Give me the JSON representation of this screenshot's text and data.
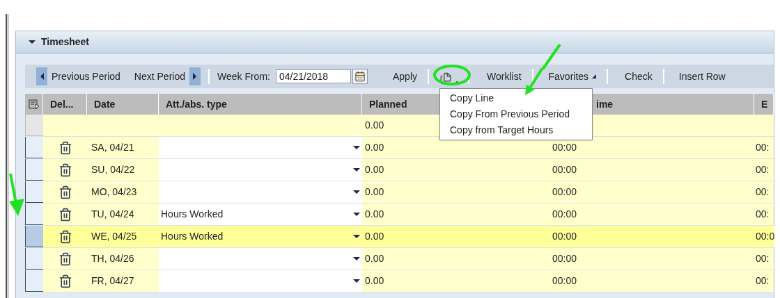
{
  "panel": {
    "title": "Timesheet",
    "expanded": true
  },
  "toolbar": {
    "previous": "Previous Period",
    "next": "Next Period",
    "week_label": "Week From:",
    "week_value": "04/21/2018",
    "apply": "Apply",
    "worklist": "Worklist",
    "favorites": "Favorites",
    "check": "Check",
    "insert_row": "Insert Row"
  },
  "copy_menu": {
    "open": true,
    "items": [
      "Copy Line",
      "Copy From Previous Period",
      "Copy from Target Hours"
    ]
  },
  "table": {
    "columns": [
      "Del...",
      "Date",
      "Att./abs. type",
      "Planned",
      "ime",
      "E"
    ],
    "rows": [
      {
        "kind": "total",
        "planned": "0.00",
        "selected": false
      },
      {
        "kind": "day",
        "date": "SA, 04/21",
        "type": "",
        "planned": "0.00",
        "time": "00:00",
        "column_6": "00:",
        "selected": false
      },
      {
        "kind": "day",
        "date": "SU, 04/22",
        "type": "",
        "planned": "0.00",
        "time": "00:00",
        "column_6": "00:",
        "selected": false
      },
      {
        "kind": "day",
        "date": "MO, 04/23",
        "type": "",
        "planned": "0.00",
        "time": "00:00",
        "column_6": "00:",
        "selected": false
      },
      {
        "kind": "day",
        "date": "TU, 04/24",
        "type": "Hours Worked",
        "planned": "0.00",
        "time": "00:00",
        "column_6": "00:",
        "selected": false
      },
      {
        "kind": "day",
        "date": "WE, 04/25",
        "type": "Hours Worked",
        "planned": "0.00",
        "time": "00:00",
        "column_6": "00:0",
        "selected": true
      },
      {
        "kind": "day",
        "date": "TH, 04/26",
        "type": "",
        "planned": "0.00",
        "time": "00:00",
        "column_6": "00:",
        "selected": false
      },
      {
        "kind": "day",
        "date": "FR, 04/27",
        "type": "",
        "planned": "0.00",
        "time": "00:00",
        "column_6": "00:",
        "selected": false
      }
    ]
  }
}
